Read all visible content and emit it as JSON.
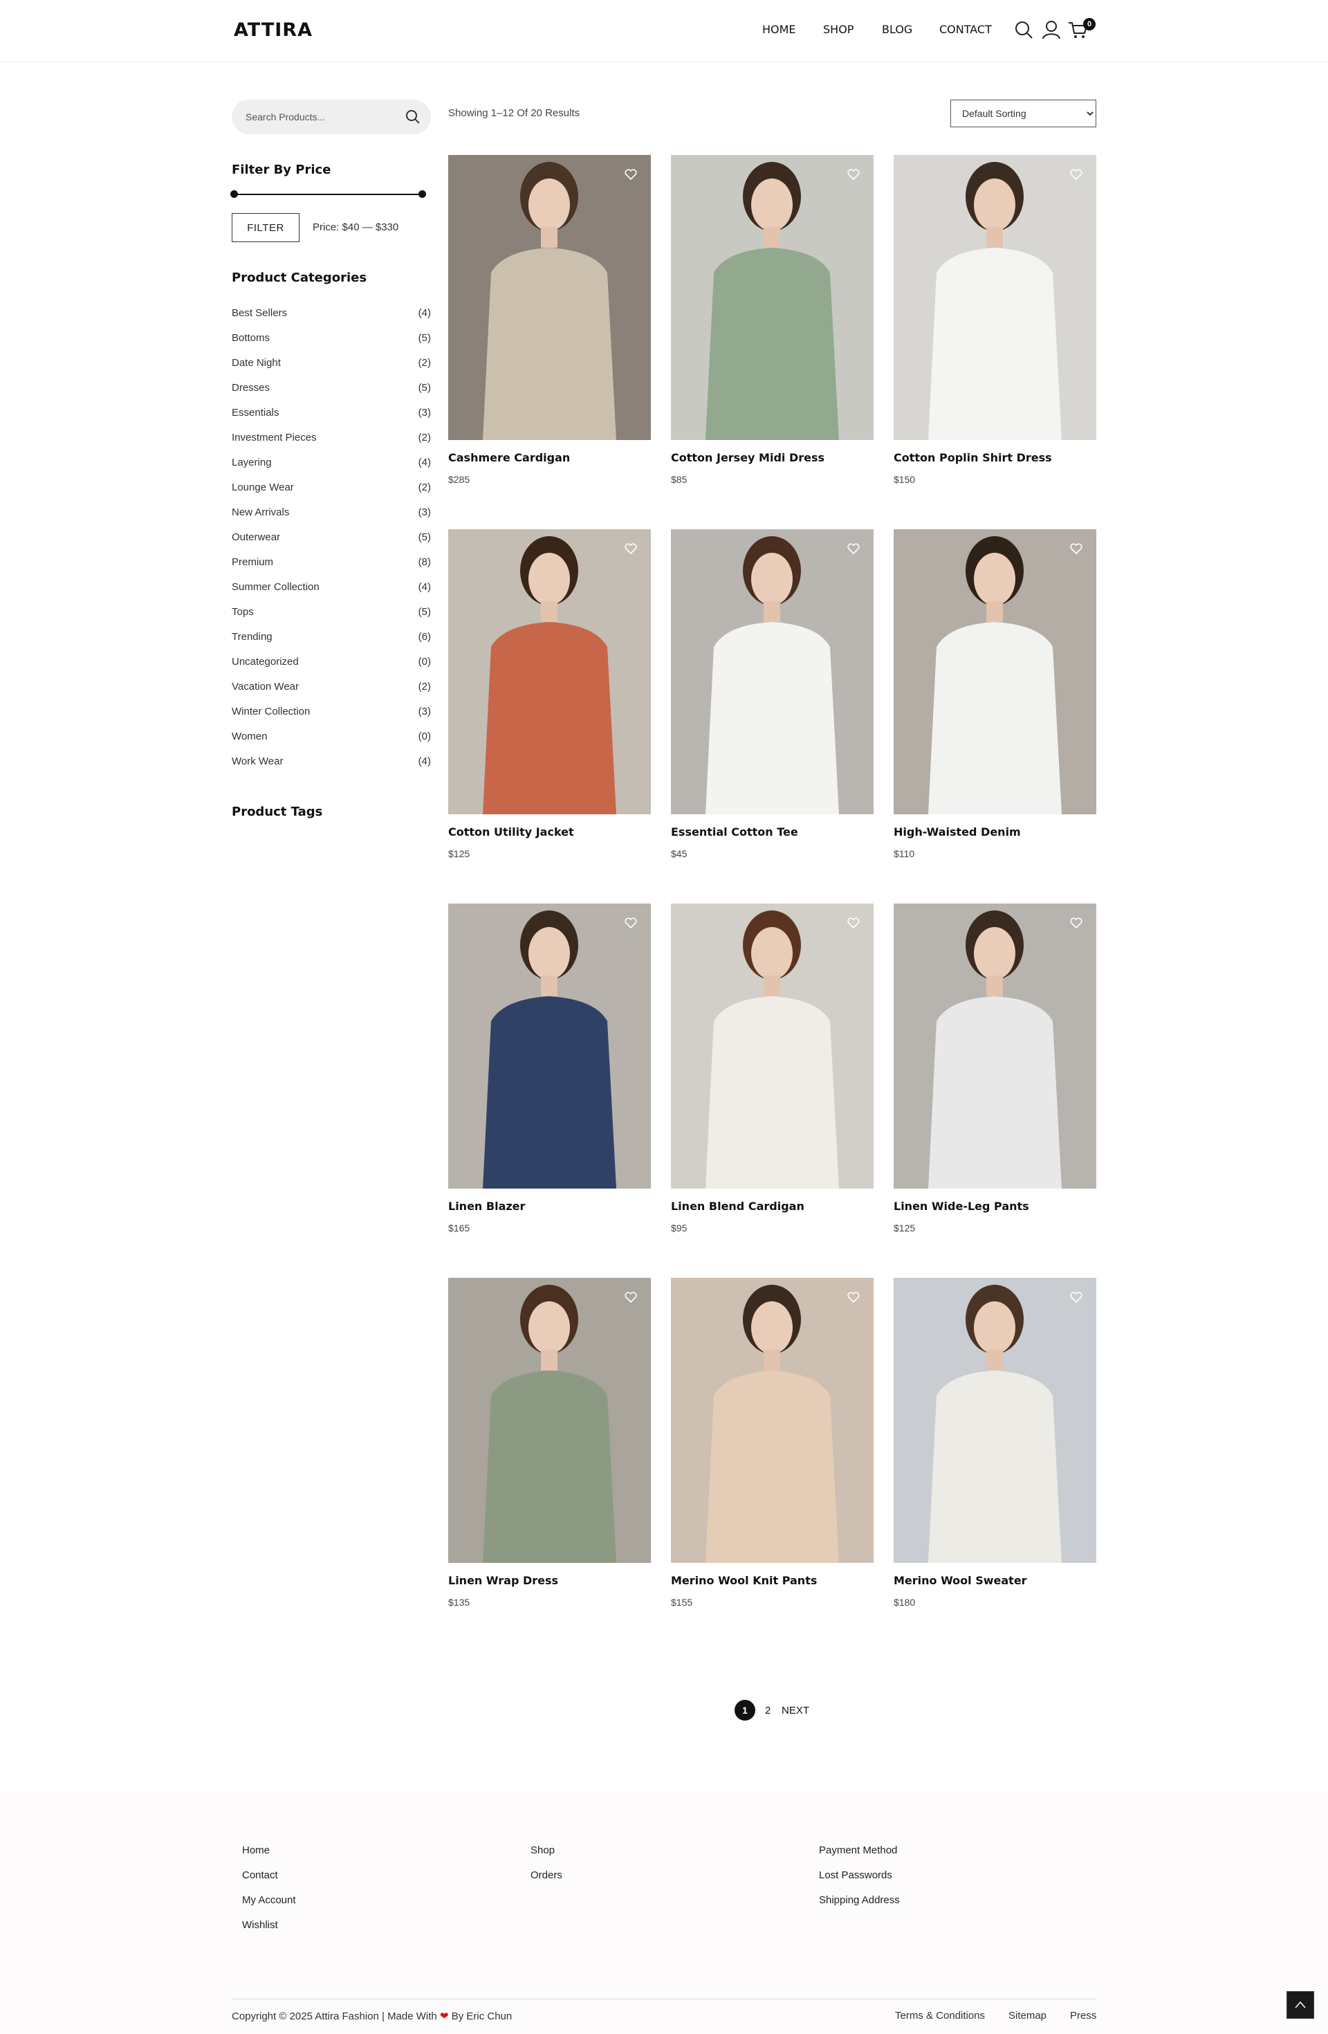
{
  "brand": {
    "logo": "ATTIRA"
  },
  "nav": {
    "items": [
      "HOME",
      "SHOP",
      "BLOG",
      "CONTACT"
    ],
    "cart_count": "0"
  },
  "icons": {
    "search": "search-icon",
    "account": "user-icon",
    "cart": "cart-icon",
    "wishlist": "heart-icon",
    "back_to_top": "chevron-up-icon"
  },
  "sidebar": {
    "search_placeholder": "Search Products...",
    "filter_title": "Filter By Price",
    "price_slider": {
      "min": 40,
      "max": 330
    },
    "filter_button": "FILTER",
    "price_range": "Price: $40 — $330",
    "categories_title": "Product Categories",
    "categories": [
      {
        "name": "Best Sellers",
        "count": "(4)"
      },
      {
        "name": "Bottoms",
        "count": "(5)"
      },
      {
        "name": "Date Night",
        "count": "(2)"
      },
      {
        "name": "Dresses",
        "count": "(5)"
      },
      {
        "name": "Essentials",
        "count": "(3)"
      },
      {
        "name": "Investment Pieces",
        "count": "(2)"
      },
      {
        "name": "Layering",
        "count": "(4)"
      },
      {
        "name": "Lounge Wear",
        "count": "(2)"
      },
      {
        "name": "New Arrivals",
        "count": "(3)"
      },
      {
        "name": "Outerwear",
        "count": "(5)"
      },
      {
        "name": "Premium",
        "count": "(8)"
      },
      {
        "name": "Summer Collection",
        "count": "(4)"
      },
      {
        "name": "Tops",
        "count": "(5)"
      },
      {
        "name": "Trending",
        "count": "(6)"
      },
      {
        "name": "Uncategorized",
        "count": "(0)"
      },
      {
        "name": "Vacation Wear",
        "count": "(2)"
      },
      {
        "name": "Winter Collection",
        "count": "(3)"
      },
      {
        "name": "Women",
        "count": "(0)"
      },
      {
        "name": "Work Wear",
        "count": "(4)"
      }
    ],
    "tags_title": "Product Tags"
  },
  "results": {
    "text": "Showing 1–12 Of 20 Results",
    "sort_selected": "Default Sorting"
  },
  "products": [
    {
      "name": "Cashmere Cardigan",
      "price": "$285"
    },
    {
      "name": "Cotton Jersey Midi Dress",
      "price": "$85"
    },
    {
      "name": "Cotton Poplin Shirt Dress",
      "price": "$150"
    },
    {
      "name": "Cotton Utility Jacket",
      "price": "$125"
    },
    {
      "name": "Essential Cotton Tee",
      "price": "$45"
    },
    {
      "name": "High-Waisted Denim",
      "price": "$110"
    },
    {
      "name": "Linen Blazer",
      "price": "$165"
    },
    {
      "name": "Linen Blend Cardigan",
      "price": "$95"
    },
    {
      "name": "Linen Wide-Leg Pants",
      "price": "$125"
    },
    {
      "name": "Linen Wrap Dress",
      "price": "$135"
    },
    {
      "name": "Merino Wool Knit Pants",
      "price": "$155"
    },
    {
      "name": "Merino Wool Sweater",
      "price": "$180"
    }
  ],
  "pagination": {
    "current": "1",
    "next_page": "2",
    "next_label": "NEXT"
  },
  "footer": {
    "col1": [
      "Home",
      "Contact",
      "My Account",
      "Wishlist"
    ],
    "col2": [
      "Shop",
      "Orders"
    ],
    "col3": [
      "Payment Method",
      "Lost Passwords",
      "Shipping Address"
    ],
    "copyright_pre": "Copyright © 2025 Attira Fashion | Made With",
    "copyright_post": "By Eric Chun",
    "links": [
      "Terms & Conditions",
      "Sitemap",
      "Press"
    ]
  }
}
